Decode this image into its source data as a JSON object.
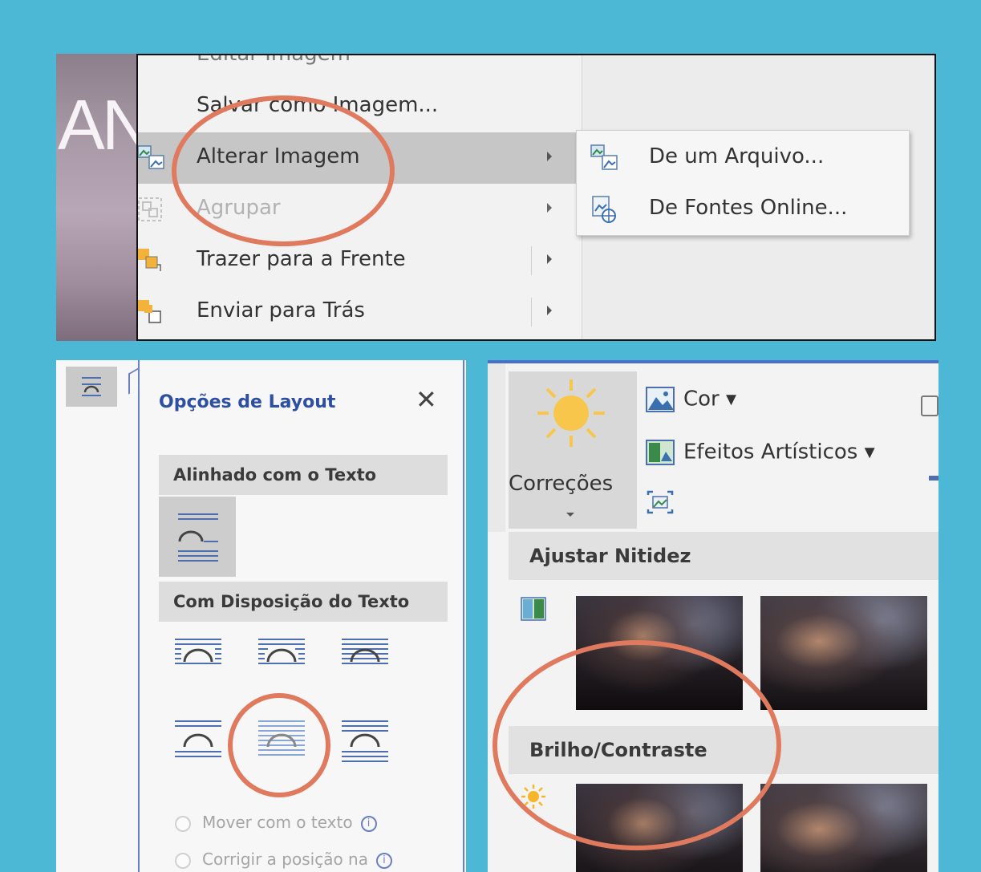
{
  "colors": {
    "background": "#4cb8d6",
    "highlight": "#e07a5f",
    "menu_hover": "#c6c6c6",
    "panel_title": "#2d4fa3",
    "panel_border": "#6a7fc4"
  },
  "context_menu": {
    "photo_text": "AN",
    "items": [
      {
        "label": "Editar Imagem",
        "icon": ""
      },
      {
        "label": "Salvar como Imagem...",
        "icon": ""
      },
      {
        "label": "Alterar Imagem",
        "icon": "change-picture-icon"
      },
      {
        "label": "Agrupar",
        "icon": "group-icon"
      },
      {
        "label": "Trazer para a Frente",
        "icon": "bring-forward-icon"
      },
      {
        "label": "Enviar para Trás",
        "icon": "send-backward-icon"
      }
    ],
    "submenu": [
      {
        "label": "De um Arquivo...",
        "icon": "from-file-icon"
      },
      {
        "label": "De Fontes Online...",
        "icon": "online-sources-icon"
      }
    ]
  },
  "layout_options": {
    "title": "Opções de Layout",
    "close": "✕",
    "inline_header": "Alinhado com o Texto",
    "wrap_header": "Com Disposição do Texto",
    "radios": [
      {
        "label": "Mover com o texto",
        "info": "i"
      },
      {
        "label": "Corrigir a posição na",
        "info": "i"
      }
    ]
  },
  "corrections": {
    "button_label": "Correções",
    "color_label": "Cor ▾",
    "effects_label": "Efeitos Artísticos ▾",
    "sharpen_header": "Ajustar Nitidez",
    "brightness_header": "Brilho/Contraste"
  }
}
